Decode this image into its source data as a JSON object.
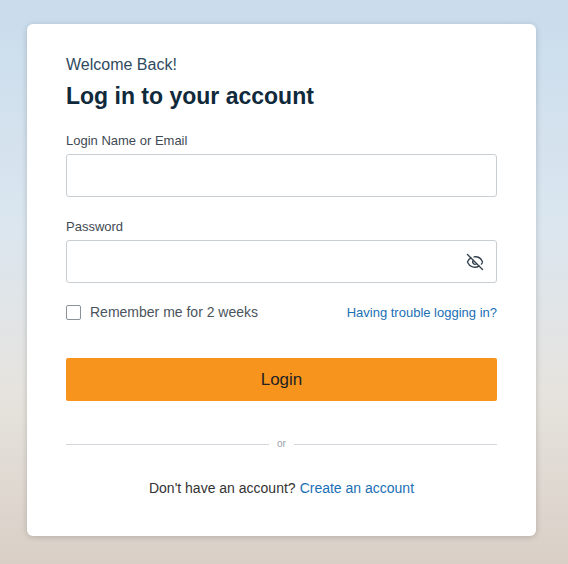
{
  "card": {
    "greeting": "Welcome Back!",
    "title": "Log in to your account"
  },
  "fields": [
    {
      "label": "Login Name or Email",
      "value": "",
      "kind": "text"
    },
    {
      "label": "Password",
      "value": "",
      "kind": "password"
    }
  ],
  "remember": {
    "label": "Remember me for 2 weeks",
    "checked": false
  },
  "trouble_link": "Having trouble logging in?",
  "login_button": "Login",
  "divider": "or",
  "signup": {
    "prompt": "Don't have an account?",
    "link": "Create an account"
  }
}
